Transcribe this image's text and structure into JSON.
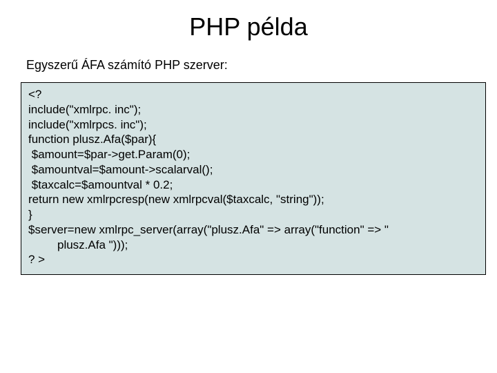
{
  "title": "PHP példa",
  "subtitle": "Egyszerű ÁFA számító PHP szerver:",
  "code": {
    "l1": "<?",
    "l2": "include(\"xmlrpc. inc\");",
    "l3": "include(\"xmlrpcs. inc\");",
    "l4": "function plusz.Afa($par){",
    "l5": " $amount=$par->get.Param(0);",
    "l6": " $amountval=$amount->scalarval();",
    "l7": " $taxcalc=$amountval * 0.2;",
    "l8": "return new xmlrpcresp(new xmlrpcval($taxcalc, \"string\"));",
    "l9": "}",
    "l10": "$server=new xmlrpc_server(array(\"plusz.Afa\" => array(\"function\" => \"",
    "l11": "plusz.Afa \")));",
    "l12": "? >"
  }
}
